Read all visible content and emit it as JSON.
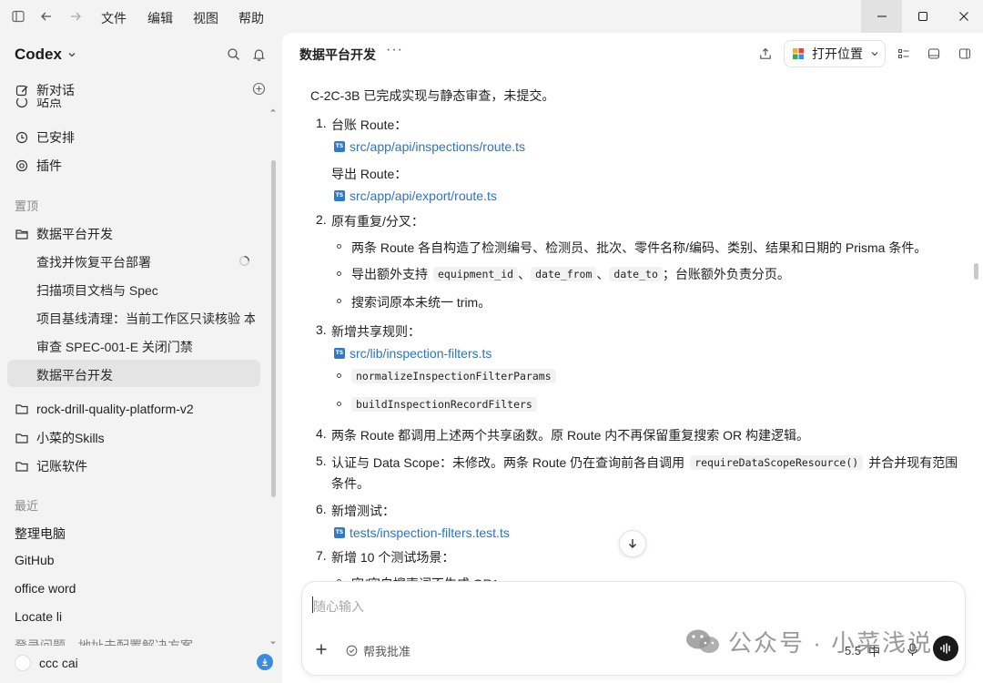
{
  "menu": {
    "file": "文件",
    "edit": "编辑",
    "view": "视图",
    "help": "帮助"
  },
  "sidebar": {
    "app_name": "Codex",
    "new_chat": "新对话",
    "nav": [
      {
        "label": "站点"
      },
      {
        "label": "已安排"
      },
      {
        "label": "插件"
      }
    ],
    "pinned_heading": "置顶",
    "pinned_project": "数据平台开发",
    "pinned_threads": [
      {
        "label": "查找并恢复平台部署"
      },
      {
        "label": "扫描项目文档与 Spec"
      },
      {
        "label": "项目基线清理：当前工作区只读核验 本"
      },
      {
        "label": "审查 SPEC-001-E 关闭门禁"
      },
      {
        "label": "数据平台开发"
      }
    ],
    "projects": [
      {
        "label": "rock-drill-quality-platform-v2"
      },
      {
        "label": "小菜的Skills"
      },
      {
        "label": "记账软件"
      }
    ],
    "recent_heading": "最近",
    "recent": [
      {
        "label": "整理电脑"
      },
      {
        "label": "GitHub"
      },
      {
        "label": "office word"
      },
      {
        "label": "Locate li"
      },
      {
        "label": "登录问题…地址未配置解决方案"
      }
    ],
    "user": "ccc cai"
  },
  "thread": {
    "title": "数据平台开发",
    "open_location": "打开位置"
  },
  "message": {
    "intro": "C-2C-3B 已完成实现与静态审查，未提交。",
    "item1_num": "1.",
    "item1_label": "台账 Route：",
    "item1_link": "src/app/api/inspections/route.ts",
    "item1b_label": "导出 Route：",
    "item1b_link": "src/app/api/export/route.ts",
    "item2_num": "2.",
    "item2_label": "原有重复/分叉：",
    "item2_b1": "两条 Route 各自构造了检测编号、检测员、批次、零件名称/编码、类别、结果和日期的 Prisma 条件。",
    "item2_b2_pre": "导出额外支持",
    "item2_b2_code1": "equipment_id",
    "item2_b2_sep1": "、",
    "item2_b2_code2": "date_from",
    "item2_b2_sep2": "、",
    "item2_b2_code3": "date_to",
    "item2_b2_post": "；台账额外负责分页。",
    "item2_b3": "搜索词原本未统一 trim。",
    "item3_num": "3.",
    "item3_label": "新增共享规则：",
    "item3_link": "src/lib/inspection-filters.ts",
    "item3_code1": "normalizeInspectionFilterParams",
    "item3_code2": "buildInspectionRecordFilters",
    "item4_num": "4.",
    "item4": "两条 Route 都调用上述两个共享函数。原 Route 内不再保留重复搜索 OR 构建逻辑。",
    "item5_num": "5.",
    "item5_pre": "认证与 Data Scope：未修改。两条 Route 仍在查询前各自调用",
    "item5_code": "requireDataScopeResource()",
    "item5_post": "并合并现有范围",
    "item5_cont": "条件。",
    "item6_num": "6.",
    "item6_label": "新增测试：",
    "item6_link": "tests/inspection-filters.test.ts",
    "item7_num": "7.",
    "item7_label": "新增 10 个测试场景：",
    "item7_b1": "空/空白搜索词不生成 OR；"
  },
  "composer": {
    "placeholder": "随心输入",
    "approve_label": "帮我批准",
    "model": "5.5",
    "effort": "中"
  },
  "watermark": "公众号 · 小菜浅说",
  "colors": {
    "link": "#2a73c9",
    "ts_badge": "#3178c6",
    "download": "#3b8be0"
  }
}
